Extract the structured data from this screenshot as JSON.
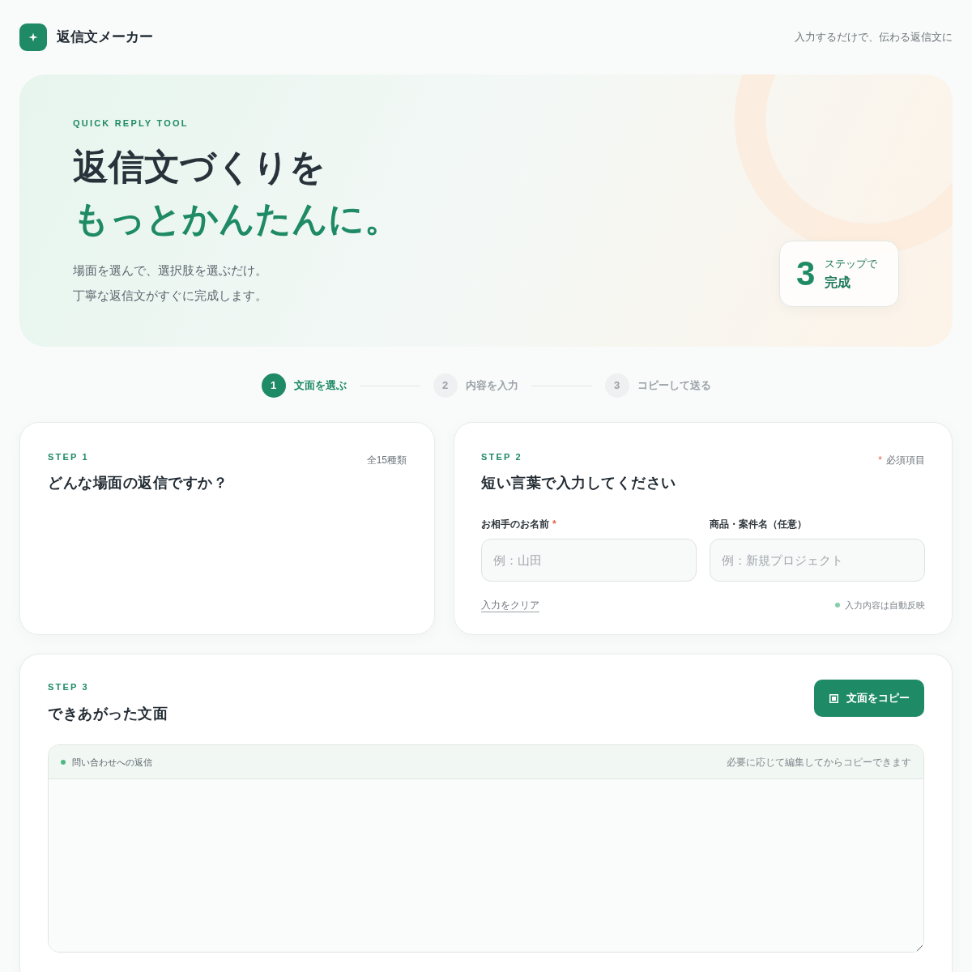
{
  "header": {
    "app_name": "返信文メーカー",
    "tagline": "入力するだけで、伝わる返信文に"
  },
  "hero": {
    "eyebrow": "QUICK REPLY TOOL",
    "title": "返信文づくりを",
    "title_highlight": "もっとかんたんに。",
    "description": [
      "場面を選んで、選択肢を選ぶだけ。",
      "丁寧な返信文がすぐに完成します。"
    ],
    "badge": {
      "number": "3",
      "caption": "ステップで",
      "label": "完成"
    }
  },
  "stepper": [
    {
      "number": "1",
      "label": "文面を選ぶ",
      "selected": true
    },
    {
      "number": "2",
      "label": "内容を入力",
      "selected": false
    },
    {
      "number": "3",
      "label": "コピーして送る",
      "selected": false
    }
  ],
  "step1": {
    "step_label": "STEP 1",
    "title": "どんな場面の返信ですか？",
    "count": "全15種類"
  },
  "step2": {
    "step_label": "STEP 2",
    "title": "短い言葉で入力してください",
    "required_note": {
      "mark": "*",
      "text": "必須項目"
    },
    "fields": [
      {
        "label": "お相手のお名前",
        "required_mark": "*",
        "placeholder": "例：山田"
      },
      {
        "label": "商品・案件名（任意）",
        "placeholder": "例：新規プロジェクト"
      }
    ],
    "clear_link": "入力をクリア",
    "auto_note": "入力内容は自動反映"
  },
  "step3": {
    "step_label": "STEP 3",
    "title": "できあがった文面",
    "copy_button": "文面をコピー",
    "output": {
      "scene": "問い合わせへの返信",
      "hint": "必要に応じて編集してからコピーできます"
    }
  }
}
